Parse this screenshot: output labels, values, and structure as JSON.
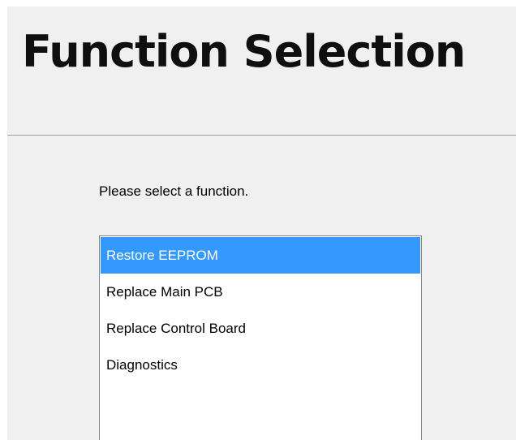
{
  "header": {
    "title": "Function Selection"
  },
  "main": {
    "prompt": "Please select a function.",
    "functions": [
      {
        "label": "Restore EEPROM",
        "selected": true
      },
      {
        "label": "Replace Main PCB",
        "selected": false
      },
      {
        "label": "Replace Control Board",
        "selected": false
      },
      {
        "label": "Diagnostics",
        "selected": false
      }
    ]
  },
  "colors": {
    "panel_background": "#f0f0f0",
    "selection_highlight": "#3399ff",
    "selection_text": "#ffffff",
    "divider": "#a0a0a0",
    "listbox_border": "#828790"
  }
}
